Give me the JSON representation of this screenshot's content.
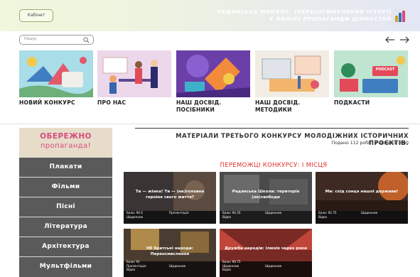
{
  "header": {
    "cabinet_label": "Кабінет",
    "site_title_line1": "Радянське минуле: (пере)осмислення історії",
    "site_title_line2": "у вимірі пропаганди цінностей"
  },
  "search": {
    "placeholder": "Пошук"
  },
  "cards": [
    {
      "label": "Новий конкурс"
    },
    {
      "label": "Про нас"
    },
    {
      "label": "Наш досвід. Посібники"
    },
    {
      "label": "Наш досвід. Методики"
    },
    {
      "label": "Подкасти",
      "badge": "PODCAST"
    }
  ],
  "sidebar": {
    "head_line1": "ОБЕРЕЖНО",
    "head_line2": "пропаганда!",
    "items": [
      {
        "label": "Плакати"
      },
      {
        "label": "Фільми"
      },
      {
        "label": "Пісні"
      },
      {
        "label": "Література"
      },
      {
        "label": "Архітектура"
      },
      {
        "label": "Мультфільми"
      }
    ]
  },
  "materials": {
    "title": "Матеріали третього конкурсу молодіжних історичних проєктів.",
    "subtitle": "Подано 112 робіт. Учасників: 660"
  },
  "winners": {
    "title": "Переможці конкурсу: I місця",
    "works": [
      {
        "caption": "Ти — жінка! Ти — (не)головна героїня свого життя?",
        "score": "Бали: 94.5",
        "type": "Презентація",
        "genre": "Щоденник"
      },
      {
        "caption": "Радянська Школа: територія (не)свободи",
        "score": "Бали: 94.35",
        "type": "Щоденник",
        "genre": "Відео"
      },
      {
        "caption": "Ми: схід сонця нашої держави!",
        "score": "Бали: 92.75",
        "type": "Щоденник",
        "genre": "Відео"
      },
      {
        "caption": "НЕ братські народи: Переосмислення",
        "score": "Бали: 91",
        "type": "Презентація",
        "genre": "Щоденник",
        "extra": "Відео",
        "genre2": "Презентація"
      },
      {
        "caption": "Дружба народів: ілюзія через роки",
        "score": "Бали: 90.75",
        "type": "Щоденник",
        "genre": "Щоденник",
        "extra": "Відео"
      }
    ]
  },
  "colors": {
    "accent_pink": "#d64c7b",
    "winners_red": "#e2322c",
    "sidebar_bg": "#5a5a5a",
    "sidebar_head_bg": "#e7dcca"
  }
}
